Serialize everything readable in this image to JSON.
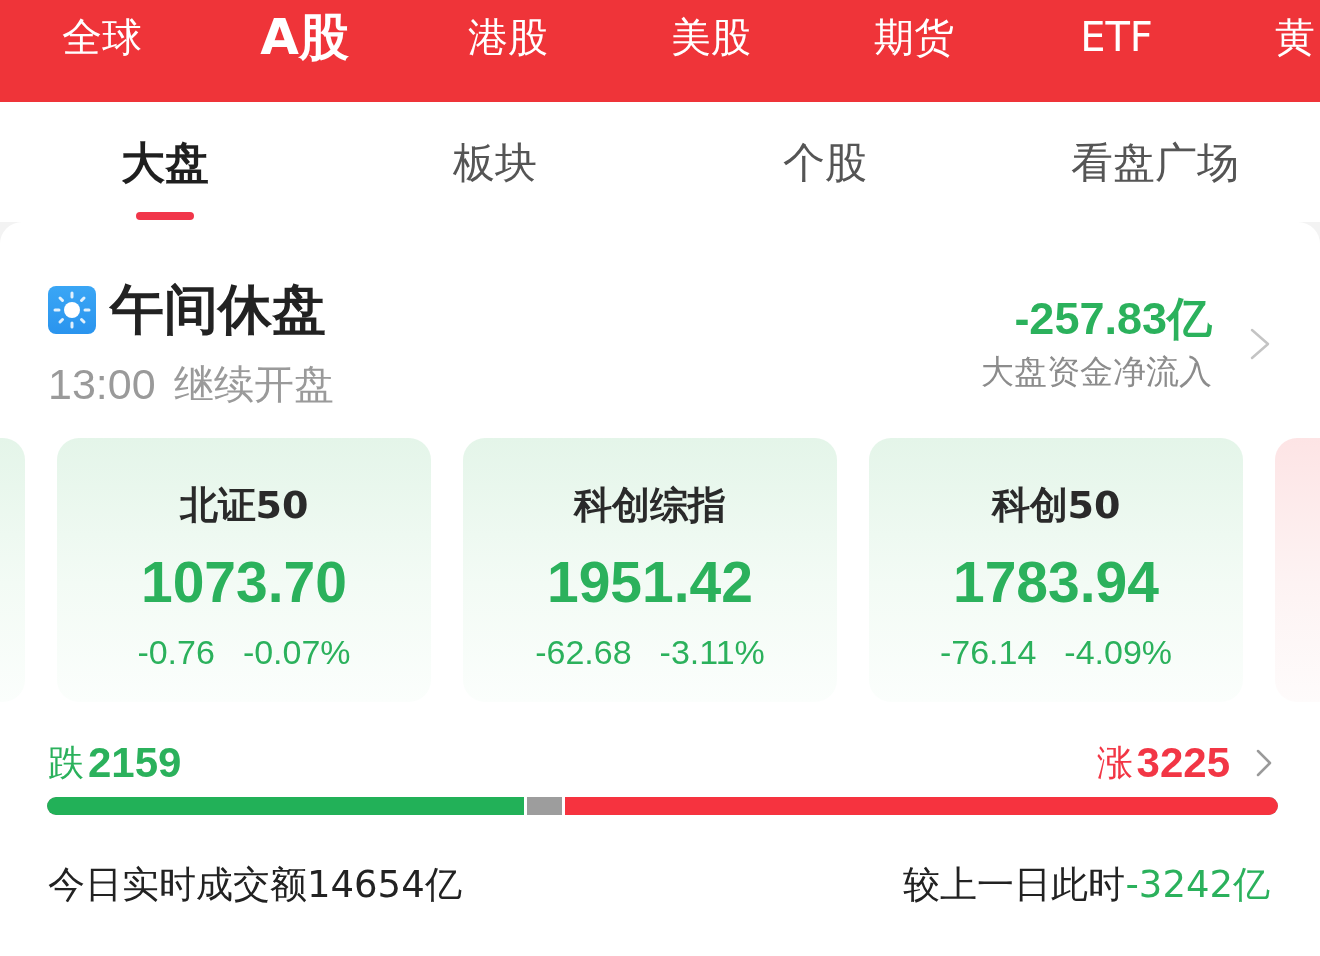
{
  "market_tabs": [
    {
      "label": "全球",
      "selected": false
    },
    {
      "label": "A股",
      "selected": true
    },
    {
      "label": "港股",
      "selected": false
    },
    {
      "label": "美股",
      "selected": false
    },
    {
      "label": "期货",
      "selected": false
    },
    {
      "label": "ETF",
      "selected": false
    },
    {
      "label": "黄",
      "selected": false
    }
  ],
  "view_tabs": [
    {
      "label": "大盘",
      "selected": true
    },
    {
      "label": "板块",
      "selected": false
    },
    {
      "label": "个股",
      "selected": false
    },
    {
      "label": "看盘广场",
      "selected": false
    }
  ],
  "session": {
    "title": "午间休盘",
    "resume_time": "13:00",
    "resume_label": "继续开盘"
  },
  "capital_flow": {
    "value": "-257.83亿",
    "label": "大盘资金净流入",
    "rising": false
  },
  "index_cards": [
    {
      "kind": "peek",
      "rising": false
    },
    {
      "kind": "full",
      "name": "北证50",
      "value": "1073.70",
      "change": "-0.76",
      "change_pct": "-0.07%",
      "rising": false
    },
    {
      "kind": "full",
      "name": "科创综指",
      "value": "1951.42",
      "change": "-62.68",
      "change_pct": "-3.11%",
      "rising": false
    },
    {
      "kind": "full",
      "name": "科创50",
      "value": "1783.94",
      "change": "-76.14",
      "change_pct": "-4.09%",
      "rising": false
    },
    {
      "kind": "peek",
      "rising": true
    }
  ],
  "breadth": {
    "fall_label": "跌",
    "fall_count": "2159",
    "rise_label": "涨",
    "rise_count": "3225",
    "fall": {
      "level": 0.39
    },
    "rise": {
      "level": 0.582
    }
  },
  "turnover": {
    "text": "今日实时成交额14654亿",
    "compare_label": "较上一日此时",
    "compare_value": "-3242亿",
    "compare_rising": false
  }
}
